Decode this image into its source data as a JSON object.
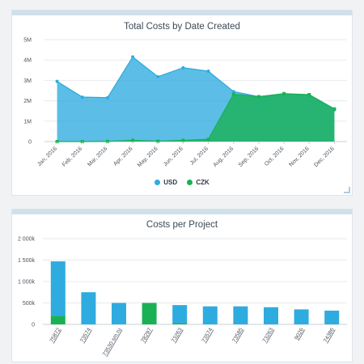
{
  "colors": {
    "usd": "#2eacdf",
    "czk": "#1ab155",
    "grid": "#e6eaee",
    "axis": "#c7cfd6"
  },
  "card1": {
    "title": "Total Costs by Date Created"
  },
  "card2": {
    "title": "Costs per Project"
  },
  "legend": [
    {
      "label": "USD",
      "color": "#2eacdf"
    },
    {
      "label": "CZK",
      "color": "#1ab155"
    }
  ],
  "chart_data": [
    {
      "type": "area",
      "title": "Total Costs by Date Created",
      "categories": [
        "Jan, 2016",
        "Feb, 2016",
        "Mar, 2016",
        "Apr, 2016",
        "May, 2016",
        "Jun, 2016",
        "Jul, 2016",
        "Aug, 2016",
        "Sep, 2016",
        "Oct, 2016",
        "Nov, 2016",
        "Dec, 2016"
      ],
      "y_ticks": [
        "0",
        "1M",
        "2M",
        "3M",
        "4M",
        "5M"
      ],
      "ylim": [
        0,
        5000000
      ],
      "series": [
        {
          "name": "USD",
          "values": [
            2950000,
            2180000,
            2150000,
            4150000,
            3180000,
            3620000,
            3450000,
            2450000,
            2200000,
            2330000,
            2280000,
            1560000
          ]
        },
        {
          "name": "CZK",
          "values": [
            0,
            0,
            10000,
            60000,
            20000,
            60000,
            110000,
            2320000,
            2200000,
            2350000,
            2300000,
            1600000
          ]
        }
      ],
      "legend_position": "bottom",
      "grid": true
    },
    {
      "type": "bar",
      "title": "Costs per Project",
      "categories": [
        "75872",
        "73574",
        "73530 sm.ru",
        "78297",
        "73263",
        "73574",
        "73585",
        "73263",
        "9026",
        "74386"
      ],
      "y_ticks": [
        "0",
        "500k",
        "1 000k",
        "1 500k",
        "2 000k"
      ],
      "ylim": [
        0,
        2000000
      ],
      "stacked": true,
      "series": [
        {
          "name": "USD",
          "values": [
            1270000,
            750000,
            500000,
            0,
            420000,
            420000,
            420000,
            400000,
            350000,
            320000
          ]
        },
        {
          "name": "CZK",
          "values": [
            200000,
            0,
            0,
            500000,
            30000,
            0,
            0,
            0,
            0,
            0
          ]
        }
      ],
      "grid": true
    }
  ]
}
